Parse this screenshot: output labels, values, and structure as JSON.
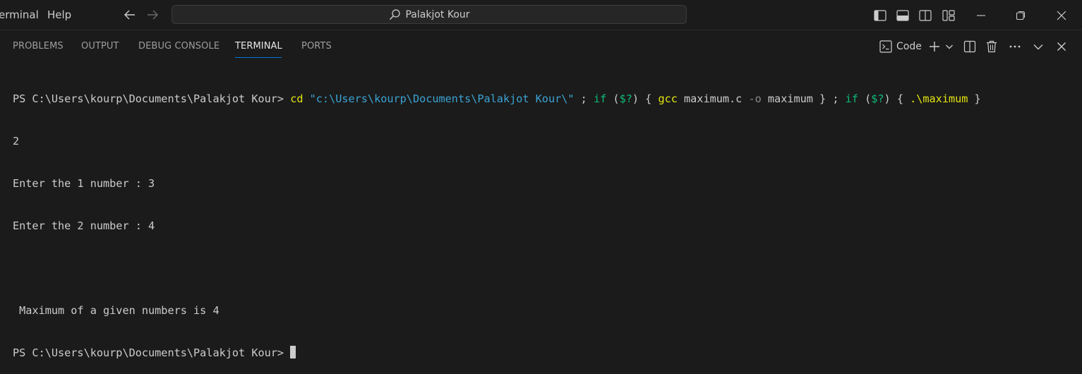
{
  "titlebar": {
    "menu": [
      "erminal",
      "Help"
    ],
    "search_text": "Palakjot Kour"
  },
  "panel": {
    "tabs": [
      {
        "label": "PROBLEMS",
        "active": false
      },
      {
        "label": "OUTPUT",
        "active": false
      },
      {
        "label": "DEBUG CONSOLE",
        "active": false
      },
      {
        "label": "TERMINAL",
        "active": true
      },
      {
        "label": "PORTS",
        "active": false
      }
    ],
    "terminal_profile_label": "Code"
  },
  "terminal": {
    "prompt": "PS C:\\Users\\kourp\\Documents\\Palakjot Kour> ",
    "command": {
      "cd": "cd",
      "path": "\"c:\\Users\\kourp\\Documents\\Palakjot Kour\\\"",
      "sep1": " ; ",
      "if1": "if",
      "cond1_open": " (",
      "cond1_var": "$?",
      "cond1_close": ") { ",
      "gcc": "gcc",
      "gcc_args1": " maximum.c ",
      "flag": "-o",
      "gcc_args2": " maximum } ; ",
      "if2": "if",
      "cond2_open": " (",
      "cond2_var": "$?",
      "cond2_close": ") { ",
      "run": ".\\maximum",
      "end": " }"
    },
    "output_lines": [
      "2",
      "Enter the 1 number : 3",
      "Enter the 2 number : 4",
      "",
      " Maximum of a given numbers is 4"
    ],
    "final_prompt": "PS C:\\Users\\kourp\\Documents\\Palakjot Kour> "
  },
  "colors": {
    "background": "#1b1b1b",
    "accent": "#0078d4",
    "command_yellow": "#e5e510",
    "string_blue": "#3ba3d4",
    "keyword_green": "#0dbc79"
  }
}
